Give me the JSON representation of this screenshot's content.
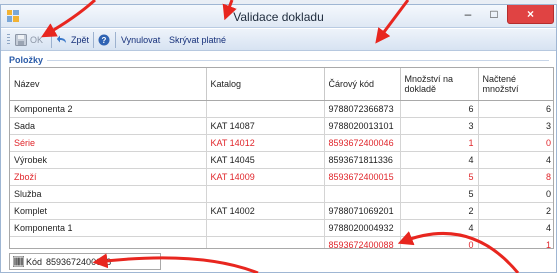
{
  "window": {
    "title": "Validace dokladu",
    "minimize_glyph": "–",
    "maximize_glyph": "□",
    "close_glyph": "×"
  },
  "toolbar": {
    "ok_label": "OK",
    "back_label": "Zpět",
    "reset_label": "Vynulovat",
    "hide_valid_label": "Skrývat platné"
  },
  "group": {
    "label": "Položky"
  },
  "grid": {
    "columns": [
      "Název",
      "Katalog",
      "Čárový kód",
      "Množství na dokladě",
      "Načtené množství"
    ],
    "rows": [
      {
        "name": "Komponenta 2",
        "catalog": "",
        "barcode": "9788072366873",
        "qty_doc": "6",
        "qty_read": "6",
        "highlight": false
      },
      {
        "name": "Sada",
        "catalog": "KAT 14087",
        "barcode": "9788020013101",
        "qty_doc": "3",
        "qty_read": "3",
        "highlight": false
      },
      {
        "name": "Série",
        "catalog": "KAT 14012",
        "barcode": "8593672400046",
        "qty_doc": "1",
        "qty_read": "0",
        "highlight": true
      },
      {
        "name": "Výrobek",
        "catalog": "KAT 14045",
        "barcode": "8593671811336",
        "qty_doc": "4",
        "qty_read": "4",
        "highlight": false
      },
      {
        "name": "Zboží",
        "catalog": "KAT 14009",
        "barcode": "8593672400015",
        "qty_doc": "5",
        "qty_read": "8",
        "highlight": true
      },
      {
        "name": "Služba",
        "catalog": "",
        "barcode": "",
        "qty_doc": "5",
        "qty_read": "0",
        "highlight": false
      },
      {
        "name": "Komplet",
        "catalog": "KAT 14002",
        "barcode": "9788071069201",
        "qty_doc": "2",
        "qty_read": "2",
        "highlight": false
      },
      {
        "name": "Komponenta 1",
        "catalog": "",
        "barcode": "9788020004932",
        "qty_doc": "4",
        "qty_read": "4",
        "highlight": false
      },
      {
        "name": "",
        "catalog": "",
        "barcode": "8593672400088",
        "qty_doc": "0",
        "qty_read": "1",
        "highlight": true
      }
    ]
  },
  "status": {
    "code_label": "Kód",
    "code_value": "8593672400088"
  },
  "colors": {
    "accent": "#2a5ba8",
    "error_text": "#e0262b",
    "close_button": "#e04343",
    "annotation_arrow": "#e8261f"
  }
}
